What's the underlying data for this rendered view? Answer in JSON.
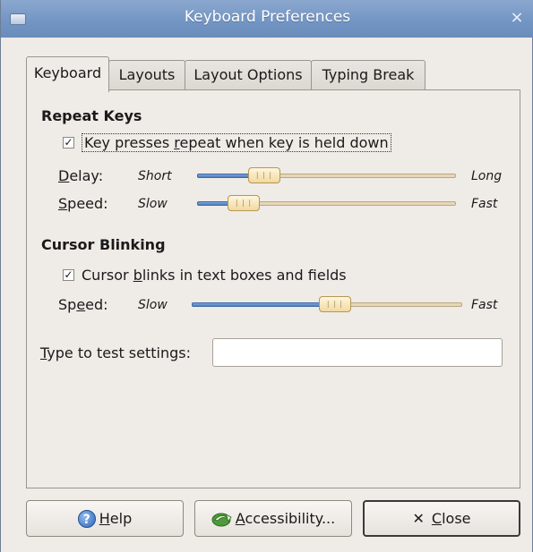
{
  "window": {
    "title": "Keyboard Preferences",
    "close_glyph": "×"
  },
  "tabs": [
    {
      "label": "Keyboard",
      "active": true
    },
    {
      "label": "Layouts",
      "active": false
    },
    {
      "label": "Layout Options",
      "active": false
    },
    {
      "label": "Typing Break",
      "active": false
    }
  ],
  "repeat_keys": {
    "title": "Repeat Keys",
    "checkbox": {
      "checked": true,
      "label_pre": "Key presses ",
      "label_mnemonic": "r",
      "label_post": "epeat when key is held down"
    },
    "delay": {
      "label_mnemonic": "D",
      "label_rest": "elay:",
      "min_label": "Short",
      "max_label": "Long",
      "value_fraction": 0.26
    },
    "speed": {
      "label_mnemonic": "S",
      "label_rest": "peed:",
      "min_label": "Slow",
      "max_label": "Fast",
      "value_fraction": 0.18
    }
  },
  "cursor_blinking": {
    "title": "Cursor Blinking",
    "checkbox": {
      "checked": true,
      "label_pre": "Cursor ",
      "label_mnemonic": "b",
      "label_post": "links in text boxes and fields"
    },
    "speed": {
      "label_pre": "Sp",
      "label_mnemonic": "e",
      "label_post": "ed:",
      "min_label": "Slow",
      "max_label": "Fast",
      "value_fraction": 0.53
    }
  },
  "test": {
    "label_mnemonic": "T",
    "label_rest": "ype to test settings:",
    "value": "",
    "placeholder": ""
  },
  "buttons": {
    "help": {
      "mnemonic": "H",
      "rest": "elp"
    },
    "accessibility": {
      "mnemonic": "A",
      "rest": "ccessibility..."
    },
    "close": {
      "icon": "✕",
      "mnemonic": "C",
      "rest": "lose"
    }
  },
  "colors": {
    "titlebar": "#7496c4",
    "slider_fill": "#4f7fbf",
    "slider_trough": "#e6d7b8",
    "window_bg": "#efebe7"
  }
}
